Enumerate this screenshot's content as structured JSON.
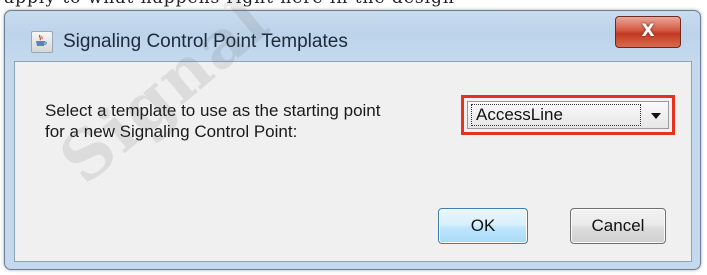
{
  "page_header_fragment": "apply to what happens right here in the design",
  "dialog": {
    "title": "Signaling Control Point Templates",
    "app_icon": "java-cup-icon",
    "close_label": "X",
    "prompt_line1": "Select a template to use as the starting point",
    "prompt_line2": "for a new Signaling Control Point:",
    "template_select": {
      "selected_value": "AccessLine",
      "highlight_color": "#e4321e"
    },
    "ok_label": "OK",
    "cancel_label": "Cancel"
  },
  "watermark": "Signal Wave IP"
}
